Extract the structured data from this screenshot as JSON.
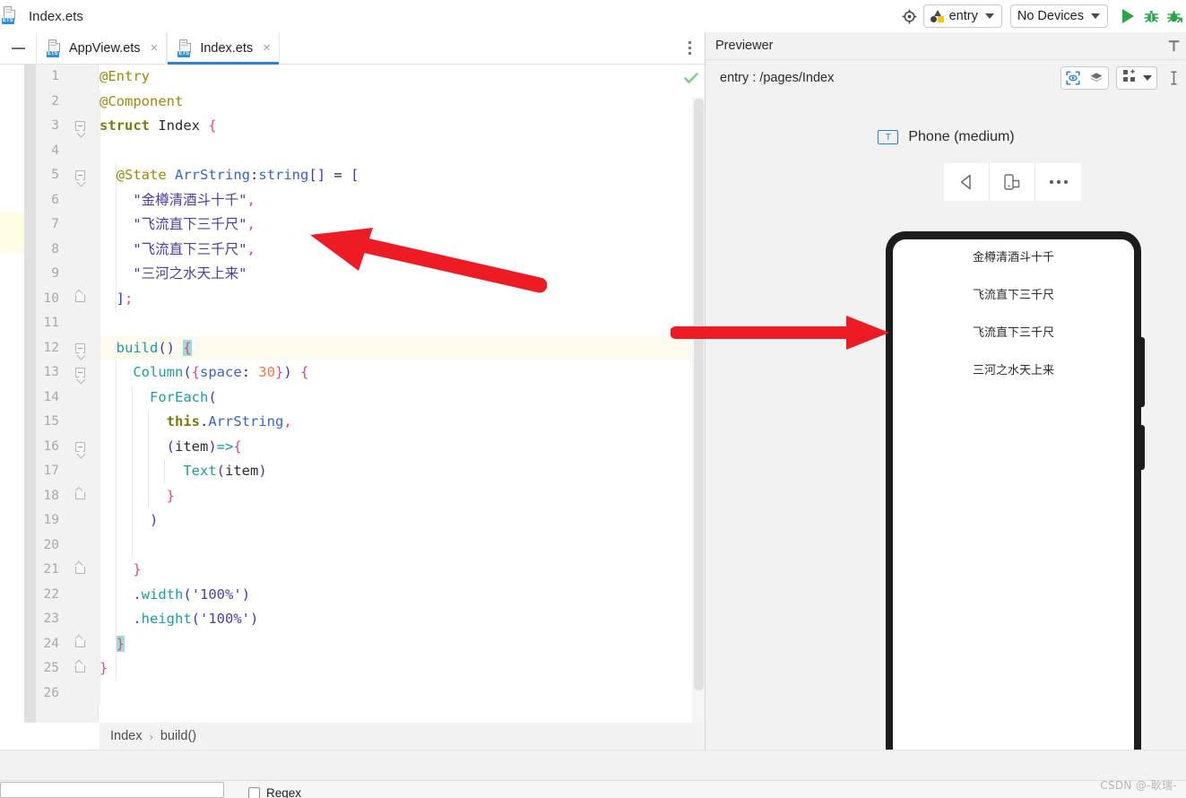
{
  "window": {
    "title": "Index.ets",
    "file_icon": "ets-file-icon",
    "tag": "ETS"
  },
  "toolbar": {
    "target_icon": "target-icon",
    "config_selector": {
      "label": "entry",
      "icon": "module-shapes-icon"
    },
    "device_selector": {
      "label": "No Devices"
    },
    "run_button": "run-icon",
    "debug_button": "debug-bug-icon",
    "attach_debug_button": "attach-debugger-icon"
  },
  "tabs": {
    "collapse_icon": "minus-icon",
    "items": [
      {
        "label": "AppView.ets",
        "active": false,
        "close": "×",
        "icon": "ets-file-icon"
      },
      {
        "label": "Index.ets",
        "active": true,
        "close": "×",
        "icon": "ets-file-icon"
      }
    ],
    "overflow_menu": "vertical-dots-icon"
  },
  "editor": {
    "status_icon": "inspection-ok-check-icon",
    "current_line": 12,
    "line_numbers": [
      1,
      2,
      3,
      4,
      5,
      6,
      7,
      8,
      9,
      10,
      11,
      12,
      13,
      14,
      15,
      16,
      17,
      18,
      19,
      20,
      21,
      22,
      23,
      24,
      25,
      26
    ],
    "lines": [
      {
        "n": 1,
        "text": "@Entry"
      },
      {
        "n": 2,
        "text": "@Component"
      },
      {
        "n": 3,
        "text": "struct Index {"
      },
      {
        "n": 4,
        "text": ""
      },
      {
        "n": 5,
        "text": "  @State ArrString:string[] = ["
      },
      {
        "n": 6,
        "text": "    \"金樽清酒斗十千\","
      },
      {
        "n": 7,
        "text": "    \"飞流直下三千尺\","
      },
      {
        "n": 8,
        "text": "    \"飞流直下三千尺\","
      },
      {
        "n": 9,
        "text": "    \"三河之水天上来\""
      },
      {
        "n": 10,
        "text": "  ];"
      },
      {
        "n": 11,
        "text": ""
      },
      {
        "n": 12,
        "text": "  build() {"
      },
      {
        "n": 13,
        "text": "    Column({space: 30}) {"
      },
      {
        "n": 14,
        "text": "      ForEach("
      },
      {
        "n": 15,
        "text": "        this.ArrString,"
      },
      {
        "n": 16,
        "text": "        (item)=>{"
      },
      {
        "n": 17,
        "text": "          Text(item)"
      },
      {
        "n": 18,
        "text": "        }"
      },
      {
        "n": 19,
        "text": "      )"
      },
      {
        "n": 20,
        "text": ""
      },
      {
        "n": 21,
        "text": "    }"
      },
      {
        "n": 22,
        "text": "    .width('100%')"
      },
      {
        "n": 23,
        "text": "    .height('100%')"
      },
      {
        "n": 24,
        "text": "  }"
      },
      {
        "n": 25,
        "text": "}"
      },
      {
        "n": 26,
        "text": ""
      }
    ]
  },
  "breadcrumb": {
    "items": [
      "Index",
      "build()"
    ],
    "separator": "›"
  },
  "previewer": {
    "title": "Previewer",
    "path": "entry : /pages/Index",
    "inspect_icon": "inspector-eye-icon",
    "layers_icon": "layers-icon",
    "grid_icon": "grid-view-icon",
    "grid_caret": "chevron-down-icon",
    "extra_icon": "text-cursor-icon",
    "header_icon": "pin-icon",
    "device": {
      "badge": "T",
      "name": "Phone (medium)",
      "buttons": [
        "back-triangle-icon",
        "rotate-device-icon",
        "more-dots-icon"
      ]
    },
    "screen_items": [
      "金樽清酒斗十千",
      "飞流直下三千尺",
      "飞流直下三千尺",
      "三河之水天上来"
    ]
  },
  "bottom": {
    "find_value": "",
    "regex_label": "Regex"
  },
  "annotations": {
    "arrow1": "red-arrow-pointing-to-code-strings",
    "arrow2": "red-arrow-pointing-to-preview"
  },
  "watermark": "CSDN @-耿瑞-",
  "colors": {
    "accent": "#2d7fd3",
    "run_green": "#2aa34a",
    "arrow_red": "#ed1c24",
    "current_line": "#fcfbee",
    "bracket_match": "#9fdcd8"
  }
}
